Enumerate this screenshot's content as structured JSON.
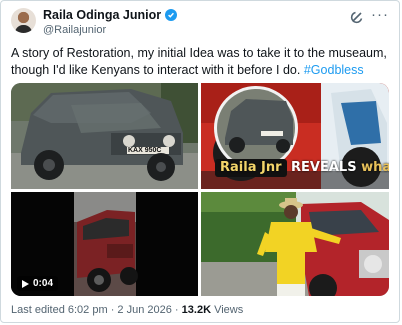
{
  "tweet": {
    "author_name": "Raila Odinga Junior",
    "author_handle": "@Railajunior",
    "more_label": "···",
    "text": "A story of Restoration, my initial Idea was to take it to the museaum, though I'd like Kenyans to interact with it before I do.",
    "hashtag": "#Godbless"
  },
  "media": {
    "video_duration": "0:04",
    "plate": "KAX 950C",
    "caption_name": "Raila Jnr",
    "caption_reveals": "REVEALS",
    "caption_tail": "what"
  },
  "meta": {
    "edited": "Last edited 6:02 pm",
    "date": "2 Jun 2026",
    "views_count": "13.2K",
    "views_label": "Views"
  },
  "colors": {
    "link": "#1d9bf0",
    "muted": "#536471",
    "verified": "#1d9bf0"
  }
}
